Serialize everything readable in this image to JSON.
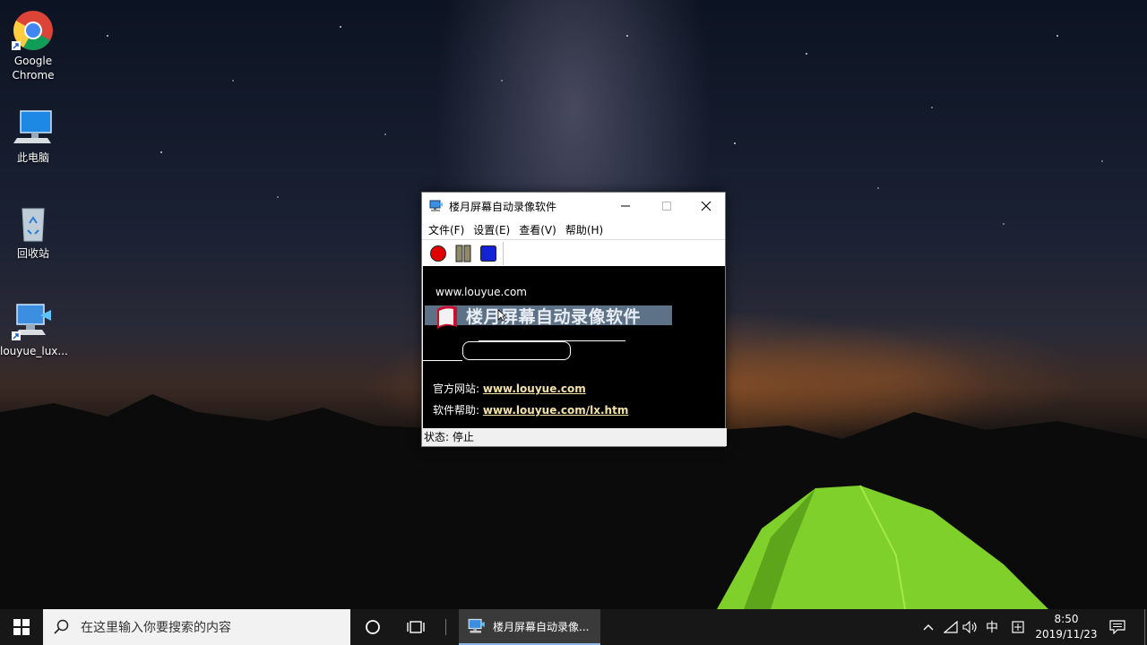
{
  "desktop": {
    "icons": [
      {
        "label": "Google\nChrome",
        "line1": "Google",
        "line2": "Chrome"
      },
      {
        "label": "此电脑"
      },
      {
        "label": "回收站"
      },
      {
        "label": "louyue_lux..."
      }
    ]
  },
  "window": {
    "title": "楼月屏幕自动录像软件",
    "menu": [
      "文件(F)",
      "设置(E)",
      "查看(V)",
      "帮助(H)"
    ],
    "toolbar": {
      "record_color": "#e10000",
      "pause_color": "#8e8a6a",
      "stop_color": "#1422d6"
    },
    "content": {
      "top_url": "www.louyue.com",
      "banner_title": "楼月屏幕自动录像软件",
      "official_label": "官方网站:",
      "official_url": "www.louyue.com",
      "help_label": "软件帮助:",
      "help_url": "www.louyue.com/lx.htm"
    },
    "status": "状态: 停止"
  },
  "taskbar": {
    "search_placeholder": "在这里输入你要搜索的内容",
    "app_label": "楼月屏幕自动录像...",
    "ime": "中",
    "clock_time": "8:50",
    "clock_date": "2019/11/23"
  }
}
